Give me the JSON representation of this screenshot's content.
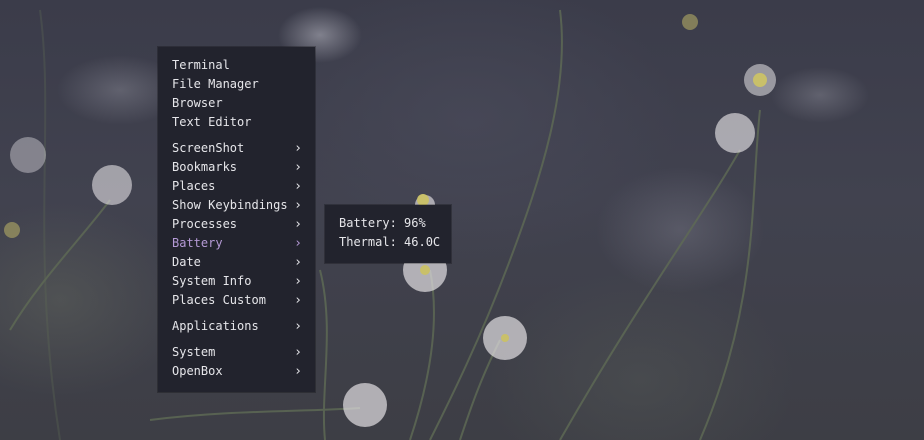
{
  "main_menu": {
    "groups": [
      [
        {
          "label": "Terminal",
          "submenu": false
        },
        {
          "label": "File Manager",
          "submenu": false
        },
        {
          "label": "Browser",
          "submenu": false
        },
        {
          "label": "Text Editor",
          "submenu": false
        }
      ],
      [
        {
          "label": "ScreenShot",
          "submenu": true
        },
        {
          "label": "Bookmarks",
          "submenu": true
        },
        {
          "label": "Places",
          "submenu": true
        },
        {
          "label": "Show Keybindings",
          "submenu": true
        },
        {
          "label": "Processes",
          "submenu": true
        },
        {
          "label": "Battery",
          "submenu": true,
          "active": true
        },
        {
          "label": "Date",
          "submenu": true
        },
        {
          "label": "System Info",
          "submenu": true
        },
        {
          "label": "Places Custom",
          "submenu": true
        }
      ],
      [
        {
          "label": "Applications",
          "submenu": true
        }
      ],
      [
        {
          "label": "System",
          "submenu": true
        },
        {
          "label": "OpenBox",
          "submenu": true
        }
      ]
    ],
    "arrow_glyph": "›",
    "active_color": "#b59ad6"
  },
  "battery_submenu": {
    "items": [
      {
        "label": "Battery: 96%"
      },
      {
        "label": "Thermal: 46.0C"
      }
    ]
  }
}
